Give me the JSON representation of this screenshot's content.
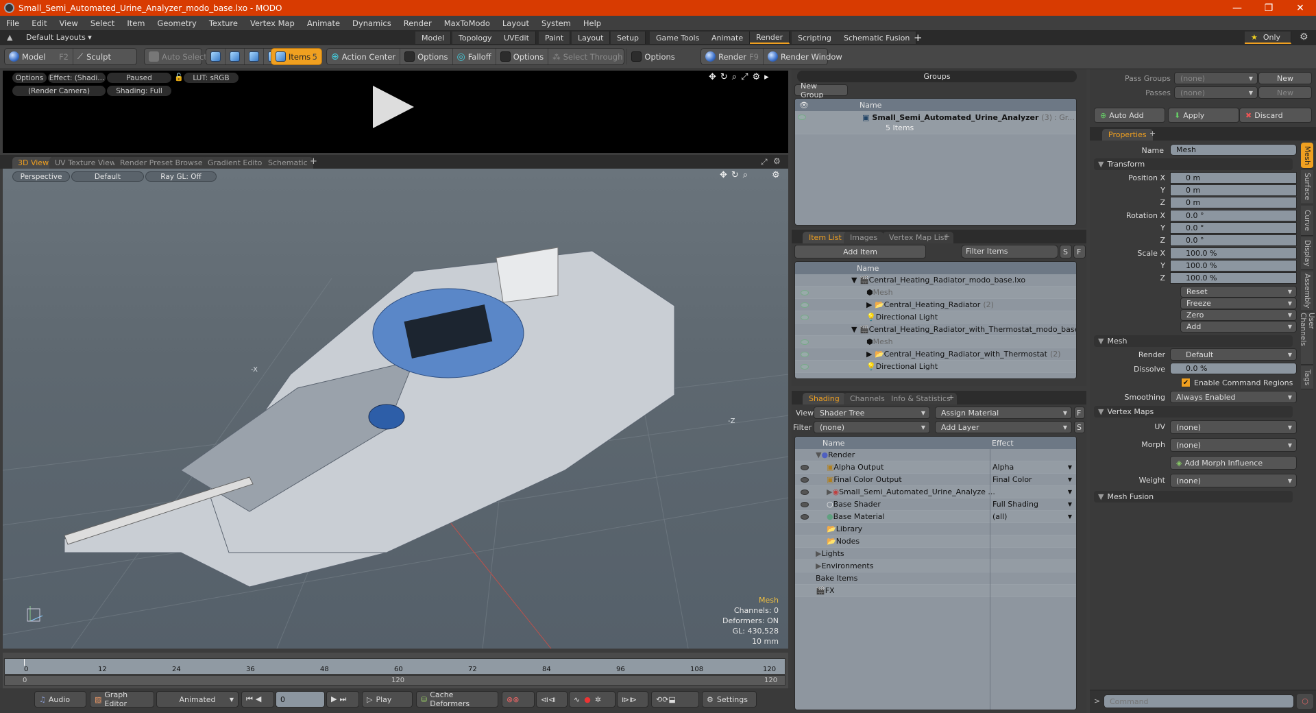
{
  "window": {
    "title": "Small_Semi_Automated_Urine_Analyzer_modo_base.lxo - MODO",
    "controls": [
      "minimize",
      "restore",
      "close"
    ]
  },
  "menu": [
    "File",
    "Edit",
    "View",
    "Select",
    "Item",
    "Geometry",
    "Texture",
    "Vertex Map",
    "Animate",
    "Dynamics",
    "Render",
    "MaxToModo",
    "Layout",
    "System",
    "Help"
  ],
  "layoutbar": {
    "layouts_label": "Default Layouts ▾",
    "tabs": [
      "Model",
      "Topology",
      "UVEdit",
      "Paint",
      "Layout",
      "Setup",
      "Game Tools",
      "Animate",
      "Render",
      "Scripting",
      "Schematic Fusion"
    ],
    "active_tab": "Render",
    "add": "+",
    "only_label": "Only"
  },
  "toolbar": {
    "model": "Model",
    "model_key": "F2",
    "sculpt": "Sculpt",
    "auto_select": "Auto Select",
    "items": "Items",
    "items_count": "5",
    "action_center": "Action Center",
    "options1": "Options",
    "falloff": "Falloff",
    "options2": "Options",
    "select_through": "Select Through",
    "options3": "Options",
    "render": "Render",
    "render_key": "F9",
    "render_window": "Render Window"
  },
  "render_preview": {
    "options": "Options",
    "effect": "Effect: (Shadi...",
    "paused": "Paused",
    "lut": "LUT: sRGB",
    "camera": "(Render Camera)",
    "shading": "Shading: Full"
  },
  "viewport_tabs": [
    "3D View",
    "UV Texture View",
    "Render Preset Browser",
    "Gradient Editor",
    "Schematic"
  ],
  "viewport": {
    "perspective": "Perspective",
    "default": "Default",
    "raygl": "Ray GL: Off",
    "hud": {
      "selection": "Mesh",
      "channels": "Channels: 0",
      "deformers": "Deformers: ON",
      "gl": "GL: 430,528",
      "scale": "10 mm"
    },
    "axis_labels": [
      "-X",
      "-Z"
    ]
  },
  "timeline": {
    "ticks": [
      "0",
      "12",
      "24",
      "36",
      "48",
      "60",
      "72",
      "84",
      "96",
      "108",
      "120"
    ],
    "range_start": "0",
    "range_mid": "120",
    "range_end": "120"
  },
  "bottombar": {
    "audio": "Audio",
    "graph_editor": "Graph Editor",
    "animated": "Animated",
    "frame": "0",
    "play": "Play",
    "cache_deformers": "Cache Deformers",
    "settings": "Settings"
  },
  "groups": {
    "title": "Groups",
    "new_group": "New Group",
    "col_name": "Name",
    "rows": [
      {
        "name": "Small_Semi_Automated_Urine_Analyzer",
        "count": "(3)",
        "suffix": ": Gr...",
        "sub": "5 Items"
      }
    ]
  },
  "itemlist": {
    "tabs": [
      "Item List",
      "Images",
      "Vertex Map List"
    ],
    "add_item": "Add Item",
    "filter": "Filter Items",
    "s": "S",
    "f": "F",
    "col_name": "Name",
    "rows": [
      {
        "name": "Central_Heating_Radiator_modo_base.lxo",
        "level": 0,
        "type": "scene",
        "count": ""
      },
      {
        "name": "Mesh",
        "level": 1,
        "type": "mesh",
        "count": "",
        "dim": true
      },
      {
        "name": "Central_Heating_Radiator",
        "level": 1,
        "type": "group",
        "count": "(2)"
      },
      {
        "name": "Directional Light",
        "level": 1,
        "type": "light",
        "count": ""
      },
      {
        "name": "Central_Heating_Radiator_with_Thermostat_modo_base.lxo",
        "level": 0,
        "type": "scene",
        "count": ""
      },
      {
        "name": "Mesh",
        "level": 1,
        "type": "mesh",
        "count": "",
        "dim": true
      },
      {
        "name": "Central_Heating_Radiator_with_Thermostat",
        "level": 1,
        "type": "group",
        "count": "(2)"
      },
      {
        "name": "Directional Light",
        "level": 1,
        "type": "light",
        "count": ""
      }
    ]
  },
  "shading": {
    "tabs": [
      "Shading",
      "Channels",
      "Info & Statistics"
    ],
    "view_label": "View",
    "view_value": "Shader Tree",
    "assign_material": "Assign Material",
    "f": "F",
    "filter_label": "Filter",
    "filter_value": "(none)",
    "add_layer": "Add Layer",
    "s": "S",
    "col_name": "Name",
    "col_effect": "Effect",
    "rows": [
      {
        "name": "Render",
        "effect": "",
        "level": 0,
        "icon": "render-sphere"
      },
      {
        "name": "Alpha Output",
        "effect": "Alpha",
        "level": 1,
        "icon": "output"
      },
      {
        "name": "Final Color Output",
        "effect": "Final Color",
        "level": 1,
        "icon": "output"
      },
      {
        "name": "Small_Semi_Automated_Urine_Analyze ...",
        "effect": "",
        "level": 1,
        "icon": "material-group"
      },
      {
        "name": "Base Shader",
        "effect": "Full Shading",
        "level": 1,
        "icon": "shader"
      },
      {
        "name": "Base Material",
        "effect": "(all)",
        "level": 1,
        "icon": "material"
      },
      {
        "name": "Library",
        "effect": "",
        "level": 1,
        "icon": "folder"
      },
      {
        "name": "Nodes",
        "effect": "",
        "level": 1,
        "icon": "folder"
      },
      {
        "name": "Lights",
        "effect": "",
        "level": 0,
        "icon": ""
      },
      {
        "name": "Environments",
        "effect": "",
        "level": 0,
        "icon": ""
      },
      {
        "name": "Bake Items",
        "effect": "",
        "level": 0,
        "icon": ""
      },
      {
        "name": "FX",
        "effect": "",
        "level": 0,
        "icon": "clapper"
      }
    ]
  },
  "passes": {
    "pass_groups_label": "Pass Groups",
    "pass_groups_value": "(none)",
    "new1": "New",
    "passes_label": "Passes",
    "passes_value": "(none)",
    "new2": "New",
    "auto_add": "Auto Add",
    "apply": "Apply",
    "discard": "Discard"
  },
  "properties": {
    "tab": "Properties",
    "name_label": "Name",
    "name_value": "Mesh",
    "transform": "Transform",
    "position": {
      "label": "Position X",
      "x": "0 m",
      "y": "0 m",
      "z": "0 m"
    },
    "rotation": {
      "label": "Rotation X",
      "x": "0.0 °",
      "y": "0.0 °",
      "z": "0.0 °"
    },
    "scale": {
      "label": "Scale X",
      "x": "100.0 %",
      "y": "100.0 %",
      "z": "100.0 %"
    },
    "axis_y": "Y",
    "axis_z": "Z",
    "actions": [
      "Reset",
      "Freeze",
      "Zero",
      "Add"
    ],
    "mesh_section": "Mesh",
    "render_label": "Render",
    "render_value": "Default",
    "dissolve_label": "Dissolve",
    "dissolve_value": "0.0 %",
    "enable_cmd": "Enable Command Regions",
    "smoothing_label": "Smoothing",
    "smoothing_value": "Always Enabled",
    "vertex_maps": "Vertex Maps",
    "uv_label": "UV",
    "uv_value": "(none)",
    "morph_label": "Morph",
    "morph_value": "(none)",
    "add_morph": "Add Morph Influence",
    "weight_label": "Weight",
    "weight_value": "(none)",
    "mesh_fusion": "Mesh Fusion",
    "side_tabs": [
      "Mesh",
      "Surface",
      "Curve",
      "Display",
      "Assembly",
      "User Channels",
      "Tags"
    ]
  },
  "command": {
    "prompt": ">",
    "placeholder": "Command"
  },
  "colors": {
    "accent": "#f0a020",
    "titlebar": "#d83b01"
  }
}
